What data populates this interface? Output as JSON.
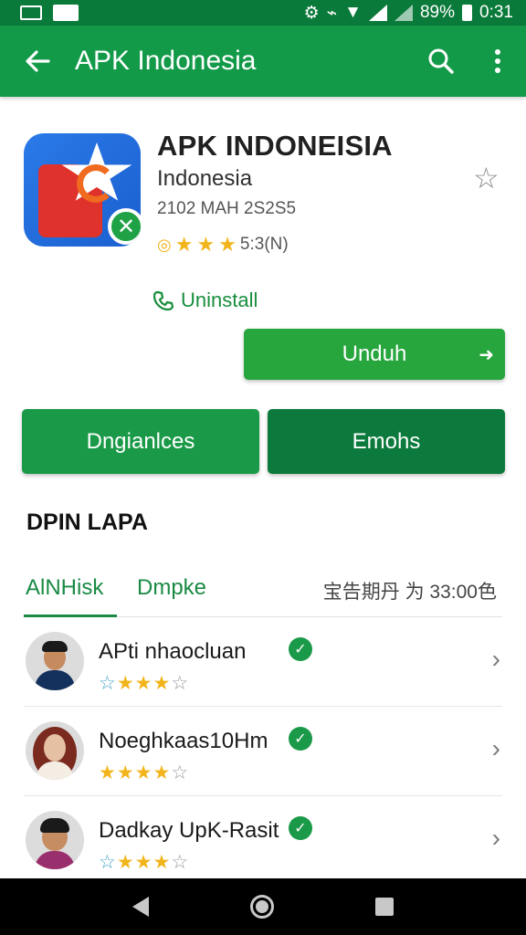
{
  "status_bar": {
    "battery_percent": "89%",
    "time": "0:31"
  },
  "appbar": {
    "title": "APK Indonesia"
  },
  "app": {
    "name": "APK INDONEISIA",
    "developer": "Indonesia",
    "size_text": "2102 MAH 2S2S5",
    "rating_text": "5:3(N)",
    "badge_glyph": "✕"
  },
  "contact": {
    "label": "Uninstall"
  },
  "buttons": {
    "download": "Unduh",
    "left": "Dngianlces",
    "right": "Emohs"
  },
  "section": {
    "title": "DPIN LAPA"
  },
  "tabs": {
    "items": [
      "AlNHisk",
      "Dmpke"
    ],
    "meta": "宝告期丹 为 33:00色"
  },
  "reviews": [
    {
      "name": "APti nhaocluan",
      "rating": 3
    },
    {
      "name": "Noeghkaas10Hm",
      "rating": 4
    },
    {
      "name": "Dadkay UpK-Rasit",
      "rating": 3
    }
  ],
  "colors": {
    "primary": "#129a48",
    "primary_dark": "#0a7a3a",
    "star": "#f2b41b"
  }
}
